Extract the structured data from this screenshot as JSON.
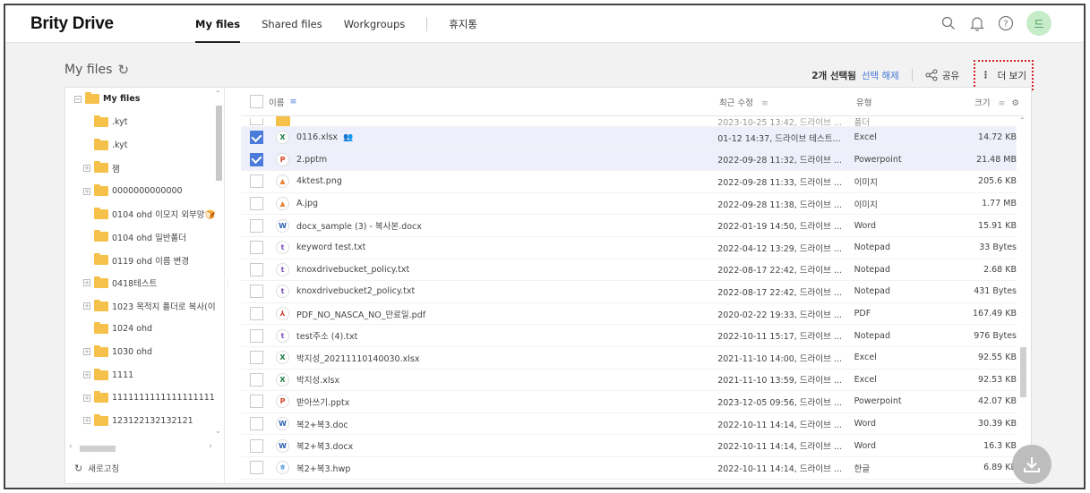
{
  "app": {
    "brand": "Brity Drive"
  },
  "nav": {
    "items": [
      {
        "label": "My files",
        "active": true
      },
      {
        "label": "Shared files",
        "active": false
      },
      {
        "label": "Workgroups",
        "active": false
      }
    ],
    "trash_label": "휴지통"
  },
  "header": {
    "avatar_initial": "드",
    "avatar_color": "#c6ecc9",
    "icons": [
      "search-icon",
      "bell-icon",
      "help-icon"
    ]
  },
  "subheader": {
    "title": "My files",
    "selected_count": "2개 선택됨",
    "clear_selection": "선택 해제",
    "share_label": "공유",
    "more_label": "더 보기"
  },
  "tree": {
    "items": [
      {
        "label": "My files",
        "expander": "−",
        "root": true
      },
      {
        "label": ".kyt",
        "expander": ""
      },
      {
        "label": ".kyt",
        "expander": ""
      },
      {
        "label": "잼",
        "expander": "+"
      },
      {
        "label": "0000000000000",
        "expander": "+"
      },
      {
        "label": "0104 ohd 이모지 외부망🍞",
        "expander": ""
      },
      {
        "label": "0104 ohd 일반폴더",
        "expander": ""
      },
      {
        "label": "0119 ohd 이름 변경",
        "expander": ""
      },
      {
        "label": "0418테스트",
        "expander": "+"
      },
      {
        "label": "1023 목적지 폴더로 복사(이",
        "expander": "+"
      },
      {
        "label": "1024 ohd",
        "expander": ""
      },
      {
        "label": "1030 ohd",
        "expander": "+"
      },
      {
        "label": "1111",
        "expander": "+"
      },
      {
        "label": "1111111111111111111111",
        "expander": "+"
      },
      {
        "label": "123122132132121",
        "expander": "+"
      }
    ],
    "refresh_label": "새로고침"
  },
  "table": {
    "headers": {
      "name": "이름",
      "modified": "최근 수정",
      "type": "유형",
      "size": "크기"
    },
    "partial_row": {
      "modified": "2023-10-25 13:42, 드라이브 ...",
      "type": "폴더"
    },
    "rows": [
      {
        "name": "0116.xlsx",
        "icon": "X",
        "icon_color": "#1e7e45",
        "modified": "01-12 14:37, 드라이브 테스트...",
        "type": "Excel",
        "size": "14.72 KB",
        "selected": true,
        "shared": true
      },
      {
        "name": "2.pptm",
        "icon": "P",
        "icon_color": "#d24726",
        "modified": "2022-09-28 11:32, 드라이브 ...",
        "type": "Powerpoint",
        "size": "21.48 MB",
        "selected": true,
        "shared": false
      },
      {
        "name": "4ktest.png",
        "icon": "▲",
        "icon_color": "#e8863a",
        "modified": "2022-09-28 11:33, 드라이브 ...",
        "type": "이미지",
        "size": "205.6 KB",
        "selected": false,
        "shared": false
      },
      {
        "name": "A.jpg",
        "icon": "▲",
        "icon_color": "#e8863a",
        "modified": "2022-09-28 11:38, 드라이브 ...",
        "type": "이미지",
        "size": "1.77 MB",
        "selected": false,
        "shared": false
      },
      {
        "name": "docx_sample (3) - 복사본.docx",
        "icon": "W",
        "icon_color": "#2b5fb4",
        "modified": "2022-01-19 14:50, 드라이브 ...",
        "type": "Word",
        "size": "15.91 KB",
        "selected": false,
        "shared": false
      },
      {
        "name": "keyword test.txt",
        "icon": "t",
        "icon_color": "#7b4fb8",
        "modified": "2022-04-12 13:29, 드라이브 ...",
        "type": "Notepad",
        "size": "33 Bytes",
        "selected": false,
        "shared": false
      },
      {
        "name": "knoxdrivebucket_policy.txt",
        "icon": "t",
        "icon_color": "#7b4fb8",
        "modified": "2022-08-17 22:42, 드라이브 ...",
        "type": "Notepad",
        "size": "2.68 KB",
        "selected": false,
        "shared": false
      },
      {
        "name": "knoxdrivebucket2_policy.txt",
        "icon": "t",
        "icon_color": "#7b4fb8",
        "modified": "2022-08-17 22:42, 드라이브 ...",
        "type": "Notepad",
        "size": "431 Bytes",
        "selected": false,
        "shared": false
      },
      {
        "name": "PDF_NO_NASCA_NO_만료일.pdf",
        "icon": "⅄",
        "icon_color": "#d23a2c",
        "modified": "2020-02-22 19:33, 드라이브 ...",
        "type": "PDF",
        "size": "167.49 KB",
        "selected": false,
        "shared": false
      },
      {
        "name": "test주소 (4).txt",
        "icon": "t",
        "icon_color": "#7b4fb8",
        "modified": "2022-10-11 15:17, 드라이브 ...",
        "type": "Notepad",
        "size": "976 Bytes",
        "selected": false,
        "shared": false
      },
      {
        "name": "박지성_20211110140030.xlsx",
        "icon": "X",
        "icon_color": "#1e7e45",
        "modified": "2021-11-10 14:00, 드라이브 ...",
        "type": "Excel",
        "size": "92.55 KB",
        "selected": false,
        "shared": false
      },
      {
        "name": "박지성.xlsx",
        "icon": "X",
        "icon_color": "#1e7e45",
        "modified": "2021-11-10 13:59, 드라이브 ...",
        "type": "Excel",
        "size": "92.53 KB",
        "selected": false,
        "shared": false
      },
      {
        "name": "받아쓰기.pptx",
        "icon": "P",
        "icon_color": "#d24726",
        "modified": "2023-12-05 09:56, 드라이브 ...",
        "type": "Powerpoint",
        "size": "42.07 KB",
        "selected": false,
        "shared": false
      },
      {
        "name": "복2+복3.doc",
        "icon": "W",
        "icon_color": "#2b5fb4",
        "modified": "2022-10-11 14:14, 드라이브 ...",
        "type": "Word",
        "size": "30.39 KB",
        "selected": false,
        "shared": false
      },
      {
        "name": "복2+복3.docx",
        "icon": "W",
        "icon_color": "#2b5fb4",
        "modified": "2022-10-11 14:14, 드라이브 ...",
        "type": "Word",
        "size": "16.3 KB",
        "selected": false,
        "shared": false
      },
      {
        "name": "복2+복3.hwp",
        "icon": "ㅎ",
        "icon_color": "#3a8fd8",
        "modified": "2022-10-11 14:14, 드라이브 ...",
        "type": "한글",
        "size": "6.89 KB",
        "selected": false,
        "shared": false
      }
    ]
  },
  "colors": {
    "accent": "#4c7cdb",
    "selected_row": "#edf0fa",
    "folder": "#f6c14a",
    "highlight_border": "#d2222d"
  }
}
